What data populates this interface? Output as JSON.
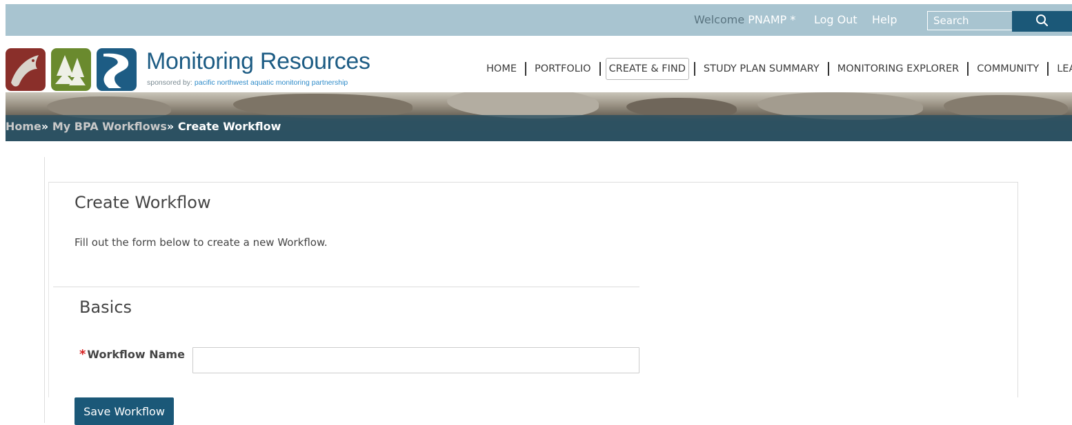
{
  "topbar": {
    "welcome": "Welcome",
    "user": "PNAMP *",
    "logout": "Log Out",
    "help": "Help",
    "search_placeholder": "Search"
  },
  "brand": {
    "title": "Monitoring Resources",
    "sponsored_by": "sponsored by:",
    "org": "pacific northwest aquatic monitoring partnership"
  },
  "nav": {
    "items": [
      "HOME",
      "PORTFOLIO",
      "CREATE & FIND",
      "STUDY PLAN SUMMARY",
      "MONITORING EXPLORER",
      "COMMUNITY",
      "LEAR"
    ],
    "active": "CREATE & FIND"
  },
  "breadcrumb": {
    "home": "Home",
    "sep": "»",
    "workflows": "My BPA Workflows",
    "current": "Create Workflow"
  },
  "page": {
    "title": "Create Workflow",
    "intro": "Fill out the form below to create a new Workflow."
  },
  "form": {
    "section_title": "Basics",
    "required_mark": "*",
    "name_label": "Workflow Name",
    "name_value": "",
    "save_label": "Save Workflow"
  },
  "colors": {
    "topbar": "#a8c4d0",
    "brand_blue": "#1d5c84",
    "button": "#1b5878",
    "required": "#d62020"
  }
}
